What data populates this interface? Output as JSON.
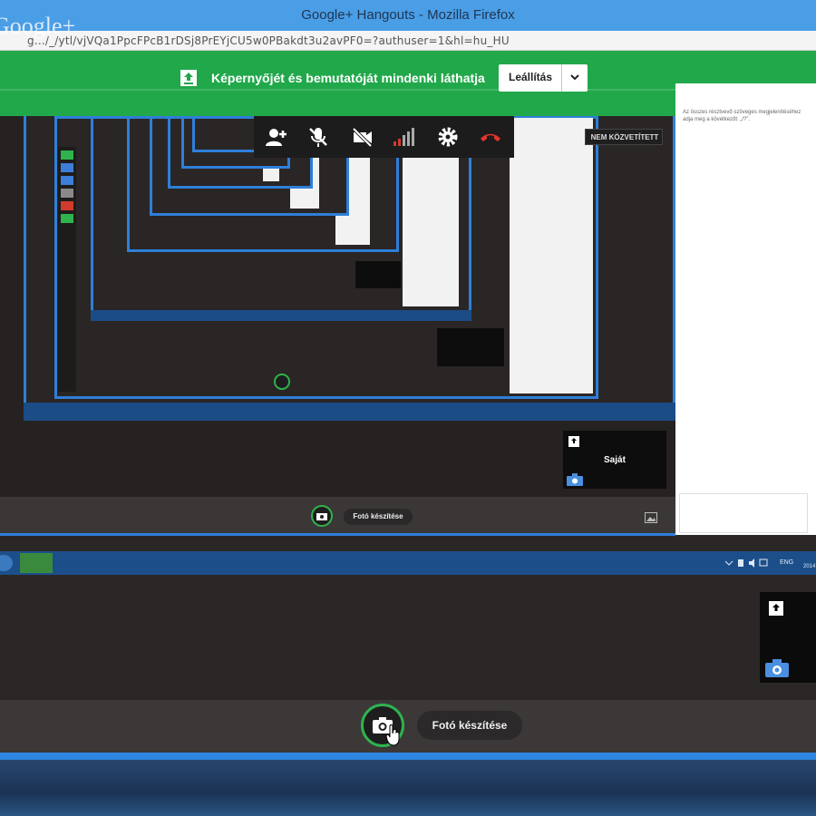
{
  "window": {
    "title": "Google+ Hangouts - Mozilla Firefox",
    "url": "g.../_/ytl/vjVQa1PpcFPcB1rDSj8PrEYjCU5w0PBakdt3u2avPF0=?authuser=1&hl=hu_HU",
    "logo_text": "Google+"
  },
  "banner": {
    "message": "Képernyőjét és bemutatóját mindenki láthatja",
    "stop_label": "Leállítás",
    "icon": "upload-screen-icon"
  },
  "toolbar": {
    "icons": [
      "add-person-icon",
      "mic-off-icon",
      "camera-off-icon",
      "signal-bars-icon",
      "gear-icon",
      "hang-up-icon"
    ]
  },
  "badges": {
    "not_broadcasted": "NEM KÖZVETÍTETT",
    "partial": "NE"
  },
  "chat": {
    "text": "Az összes résztvevő szöveges megjelenítéséhez adja meg a következőt: „/?”."
  },
  "self_tile": {
    "label": "Saját"
  },
  "photo": {
    "label": "Fotó készítése"
  },
  "taskbar": {
    "language": "ENG",
    "date": "2014"
  },
  "colors": {
    "banner_green": "#21a84a",
    "accent_blue": "#2f7fd9",
    "titlebar_blue": "#4a9ee6",
    "taskbar_blue": "#1c4f8a"
  }
}
